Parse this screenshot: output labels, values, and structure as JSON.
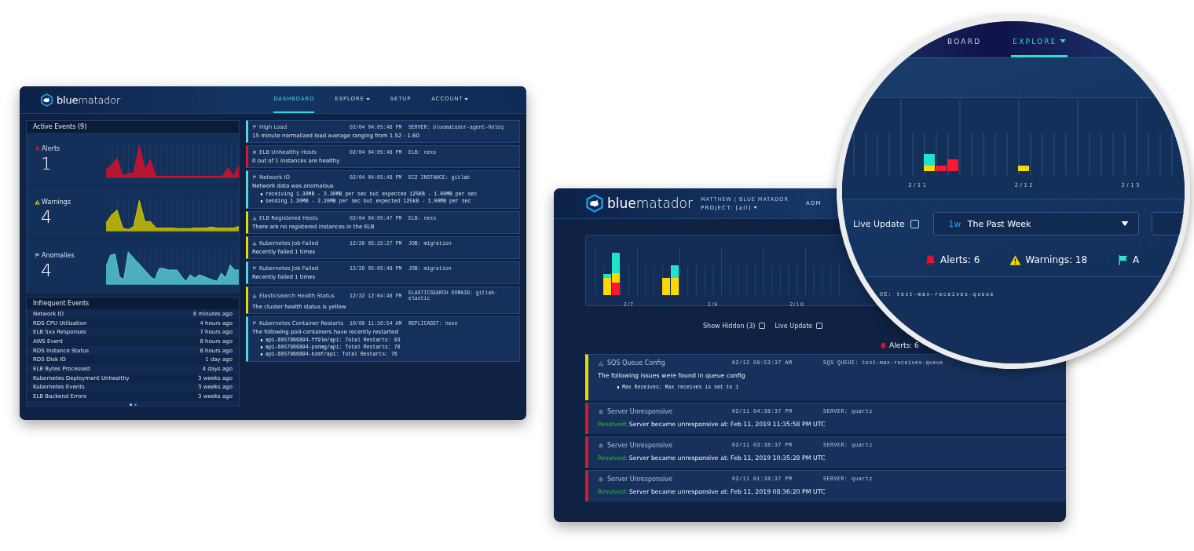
{
  "left_window": {
    "logo": "**blue**matador",
    "nav": [
      {
        "label": "DASHBOARD",
        "selected": true,
        "dropdown": false
      },
      {
        "label": "EXPLORE",
        "selected": false,
        "dropdown": true
      },
      {
        "label": "SETUP",
        "selected": false,
        "dropdown": false
      },
      {
        "label": "ACCOUNT",
        "selected": false,
        "dropdown": true
      }
    ],
    "active_events": {
      "title": "Active Events (9)",
      "categories": [
        {
          "kind": "alert",
          "label": "Alerts",
          "count": "1",
          "color": "#d0102b"
        },
        {
          "kind": "warning",
          "label": "Warnings",
          "count": "4",
          "color": "#c8c000"
        },
        {
          "kind": "anomaly",
          "label": "Anomalies",
          "count": "4",
          "color": "#56c4d0"
        }
      ]
    },
    "infrequent_events": {
      "title": "Infrequent Events",
      "rows": [
        {
          "name": "Network IO",
          "time": "8 minutes ago"
        },
        {
          "name": "RDS CPU Utilization",
          "time": "4 hours ago"
        },
        {
          "name": "ELB 5xx Responses",
          "time": "7 hours ago"
        },
        {
          "name": "AWS Event",
          "time": "8 hours ago"
        },
        {
          "name": "RDS Instance Status",
          "time": "8 hours ago"
        },
        {
          "name": "RDS Disk IO",
          "time": "1 day ago"
        },
        {
          "name": "ELB Bytes Processed",
          "time": "4 days ago"
        },
        {
          "name": "Kubernetes Deployment Unhealthy",
          "time": "3 weeks ago"
        },
        {
          "name": "Kubernetes Events",
          "time": "3 weeks ago"
        },
        {
          "name": "ELB Backend Errors",
          "time": "3 weeks ago"
        }
      ],
      "pager": [
        {
          "selected": false
        },
        {
          "selected": true
        }
      ]
    },
    "events": [
      {
        "kind": "anomaly",
        "title": "High Load",
        "time": "02/04 04:05:48 PM",
        "source": "SERVER: bluematador-agent-0dleq",
        "message": "15 minute normalized load average ranging from 1.52 - 1.60"
      },
      {
        "kind": "alert",
        "title": "ELB Unhealthy Hosts",
        "time": "02/04 04:05:48 PM",
        "source": "ELB: nexo",
        "message": "0 out of 1 instances are healthy"
      },
      {
        "kind": "anomaly",
        "title": "Network IO",
        "time": "02/04 04:05:48 PM",
        "source": "EC2 INSTANCE: gitlab",
        "message": "Network data was anomalous",
        "bullets": [
          "receiving 1.30MB - 2.30MB per sec but expected 125KB - 1.00MB per sec",
          "sending 1.20MB - 2.20MB per sec but expected 125kB - 1.00MB per sec"
        ]
      },
      {
        "kind": "warning",
        "title": "ELB Registered Hosts",
        "time": "02/04 04:05:47 PM",
        "source": "ELB: nexo",
        "message": "There are no registered instances in the ELB"
      },
      {
        "kind": "warning",
        "title": "Kubernetes Job Failed",
        "time": "12/29 05:15:27 PM",
        "source": "JOB: migration",
        "message": "Recently failed 1 times"
      },
      {
        "kind": "anomaly",
        "title": "Kubernetes Job Failed",
        "time": "12/29 05:05:48 PM",
        "source": "JOB: migration",
        "message": "Recently failed 1 times"
      },
      {
        "kind": "warning",
        "title": "Elasticsearch Health Status",
        "time": "12/22 12:04:48 PM",
        "source": "ELASTICSEARCH DOMAIN: gitlab-elastic",
        "message": "The cluster health status is yellow"
      },
      {
        "kind": "anomaly",
        "title": "Kubernetes Container Restarts",
        "time": "10/09 11:10:54 AM",
        "source": "REPLICASET: nexo",
        "message": "The following pod-containers have recently restarted",
        "bullets": [
          "api-6857966894-ff9lm/api: Total Restarts: 83",
          "api-6857966894-ponmg/api: Total Restarts: 78",
          "api-6857966894-bzmf/api: Total Restarts: 76"
        ]
      }
    ]
  },
  "right_window": {
    "logo": "**blue**matador",
    "user": "MATTHEW | BLUE MATADOR",
    "project": "PROJECT: [all]",
    "nav": [
      {
        "label": "ADM",
        "selected": false,
        "dropdown": false
      }
    ],
    "chart_labels": [
      "2/7",
      "2/9",
      "2/10"
    ],
    "toggles": [
      {
        "label": "Show Hidden (3)",
        "checked": false
      },
      {
        "label": "Live Update",
        "checked": false
      }
    ],
    "summary": [
      {
        "kind": "alert",
        "label": "Alerts: 6"
      }
    ],
    "events": [
      {
        "kind": "warning",
        "title": "SQS Queue Config",
        "time": "02/12 09:53:37 AM",
        "source": "SQS QUEUE: test-max-receives-queue",
        "message": "The following issues were found in queue config",
        "bullets": [
          "Max Receives: Max receives is set to 1"
        ]
      },
      {
        "kind": "alert",
        "title": "Server Unresponsive",
        "time": "02/11 04:38:37 PM",
        "source": "SERVER: quartz",
        "status": "Resolved:",
        "message": "Server became unresponsive at: Feb 11, 2019 11:35:58 PM UTC"
      },
      {
        "kind": "alert",
        "title": "Server Unresponsive",
        "time": "02/11 03:38:37 PM",
        "source": "SERVER: quartz",
        "status": "Resolved:",
        "message": "Server became unresponsive at: Feb 11, 2019 10:35:28 PM UTC"
      },
      {
        "kind": "alert",
        "title": "Server Unresponsive",
        "time": "02/11 01:38:37 PM",
        "source": "SERVER: quartz",
        "status": "Resolved:",
        "message": "Server became unresponsive at: Feb 11, 2019 08:36:20 PM UTC"
      }
    ]
  },
  "magnifier": {
    "nav": [
      {
        "label": "BOARD",
        "selected": false,
        "dropdown": false
      },
      {
        "label": "EXPLORE",
        "selected": true,
        "dropdown": true
      }
    ],
    "chart_labels": [
      "2/11",
      "2/12",
      "2/13"
    ],
    "toggle": {
      "label": "Live Update",
      "checked": false
    },
    "range": {
      "code": "1w",
      "label": "The Past Week"
    },
    "summary": [
      {
        "kind": "alert",
        "label": "Alerts: 6"
      },
      {
        "kind": "warning",
        "label": "Warnings: 18"
      },
      {
        "kind": "anomaly",
        "label": "A"
      }
    ],
    "event_source": "UE: test-max-receives-queue"
  }
}
